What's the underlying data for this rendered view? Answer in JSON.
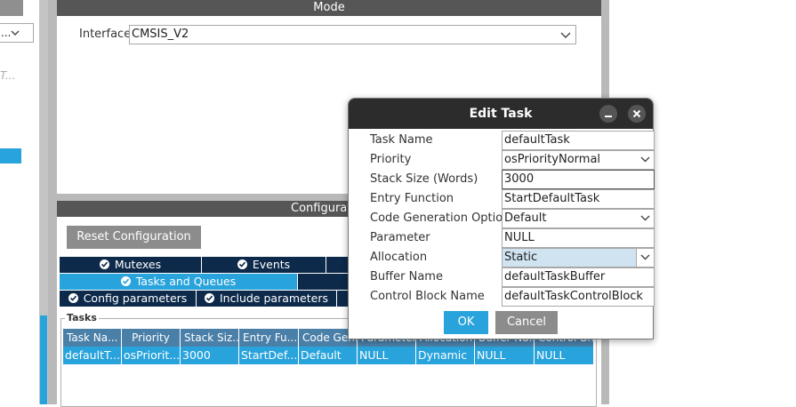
{
  "left_panel": {
    "dropdown_value": "...",
    "truncated_text": "T..."
  },
  "mode_panel": {
    "title": "Mode",
    "interface_label": "Interface",
    "interface_value": "CMSIS_V2"
  },
  "config_panel": {
    "title_partial": "Configurati",
    "reset_button": "Reset Configuration",
    "tabs_row1": [
      "Mutexes",
      "Events"
    ],
    "tab_active": "Tasks and Queues",
    "tabs_row3": [
      "Config parameters",
      "Include parameters"
    ],
    "tasks_group_label": "Tasks",
    "columns": [
      "Task Na...",
      "Priority",
      "Stack Siz...",
      "Entry Fu...",
      "Code Gen...",
      "Parameter",
      "Allocation",
      "Buffer Na...",
      "Control B..."
    ],
    "rows": [
      [
        "defaultT...",
        "osPriorit...",
        "3000",
        "StartDef...",
        "Default",
        "NULL",
        "Dynamic",
        "NULL",
        "NULL"
      ]
    ]
  },
  "dialog": {
    "title": "Edit Task",
    "minimize_icon": "minimize-icon",
    "close_icon": "close-icon",
    "fields": [
      {
        "label": "Task Name",
        "value": "defaultTask"
      },
      {
        "label": "Priority",
        "value": "osPriorityNormal"
      },
      {
        "label": "Stack Size (Words)",
        "value": "3000"
      },
      {
        "label": "Entry Function",
        "value": "StartDefaultTask"
      },
      {
        "label": "Code Generation Option",
        "value": "Default"
      },
      {
        "label": "Parameter",
        "value": "NULL"
      },
      {
        "label": "Allocation",
        "value": "Static"
      },
      {
        "label": "Buffer Name",
        "value": "defaultTaskBuffer"
      },
      {
        "label": "Control Block Name",
        "value": "defaultTaskControlBlock"
      }
    ],
    "ok_button": "OK",
    "cancel_button": "Cancel"
  },
  "colors": {
    "dark_navy": "#0d2a4a",
    "light_blue": "#29a3dc",
    "button_gray": "#8c8c8c",
    "dialog_title_bg": "#2c2c2c",
    "allocation_highlight": "#cfe3f1"
  }
}
